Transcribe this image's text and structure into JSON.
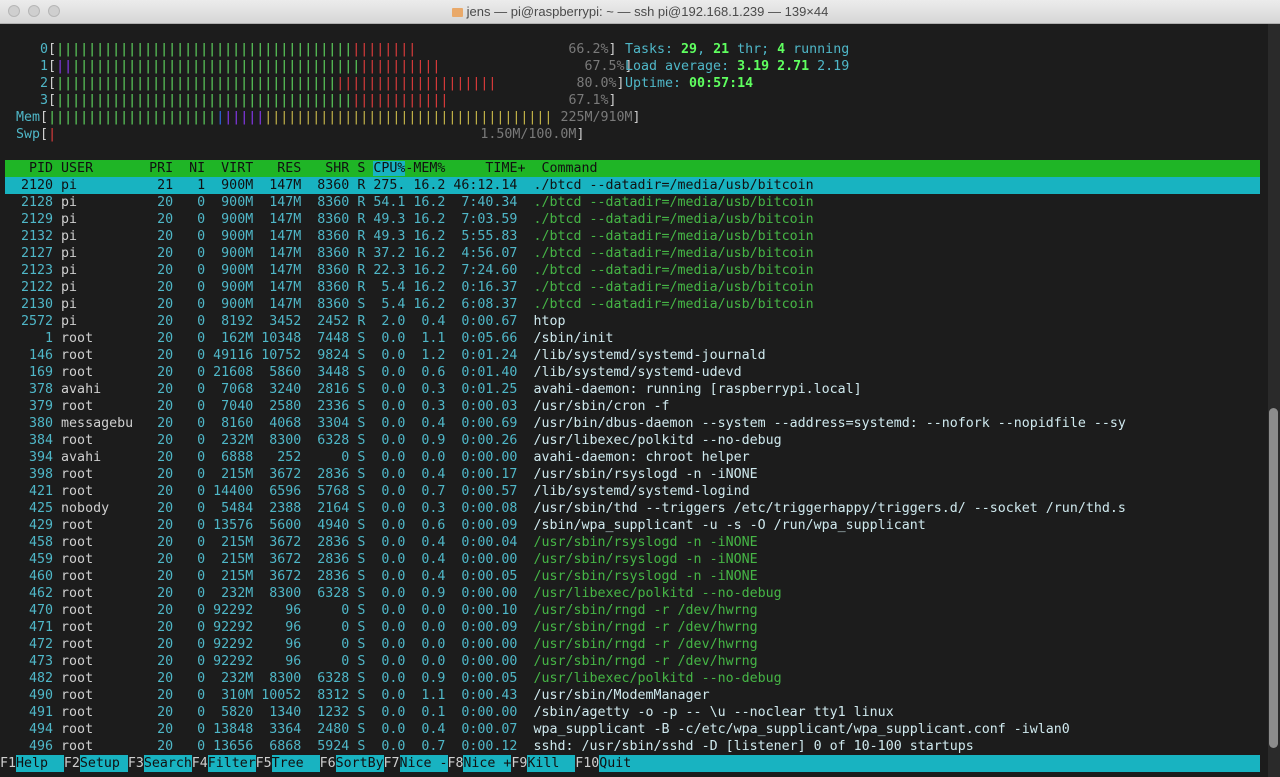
{
  "window": {
    "title": "jens — pi@raspberrypi: ~ — ssh pi@192.168.1.239 — 139×44"
  },
  "cpus": [
    {
      "id": "0",
      "percent": "66.2%"
    },
    {
      "id": "1",
      "percent": "67.5%"
    },
    {
      "id": "2",
      "percent": "80.0%"
    },
    {
      "id": "3",
      "percent": "67.1%"
    }
  ],
  "mem": {
    "label": "Mem",
    "value": "225M/910M"
  },
  "swp": {
    "label": "Swp",
    "value": "1.50M/100.0M"
  },
  "stats": {
    "tasks_label": "Tasks: ",
    "tasks": "29",
    "thr": "21",
    "thr_label": " thr; ",
    "running": "4",
    "running_label": " running",
    "load_label": "Load average: ",
    "load1": "3.19",
    "load5": "2.71",
    "load15": "2.19",
    "uptime_label": "Uptime: ",
    "uptime": "00:57:14"
  },
  "columns": {
    "pid": "PID",
    "user": "USER",
    "pri": "PRI",
    "ni": "NI",
    "virt": "VIRT",
    "res": "RES",
    "shr": "SHR",
    "s": "S",
    "cpu": "CPU%",
    "mem": "MEM%",
    "time": "TIME+",
    "command": "Command"
  },
  "processes": [
    {
      "pid": "2120",
      "user": "pi",
      "pri": "21",
      "ni": "1",
      "virt": "900M",
      "res": "147M",
      "shr": "8360",
      "s": "R",
      "cpu": "275.",
      "mem": "16.2",
      "time": "46:12.14",
      "command": "./btcd --datadir=/media/usb/bitcoin"
    },
    {
      "pid": "2128",
      "user": "pi",
      "pri": "20",
      "ni": "0",
      "virt": "900M",
      "res": "147M",
      "shr": "8360",
      "s": "R",
      "cpu": "54.1",
      "mem": "16.2",
      "time": "7:40.34",
      "command": "./btcd --datadir=/media/usb/bitcoin"
    },
    {
      "pid": "2129",
      "user": "pi",
      "pri": "20",
      "ni": "0",
      "virt": "900M",
      "res": "147M",
      "shr": "8360",
      "s": "R",
      "cpu": "49.3",
      "mem": "16.2",
      "time": "7:03.59",
      "command": "./btcd --datadir=/media/usb/bitcoin"
    },
    {
      "pid": "2132",
      "user": "pi",
      "pri": "20",
      "ni": "0",
      "virt": "900M",
      "res": "147M",
      "shr": "8360",
      "s": "R",
      "cpu": "49.3",
      "mem": "16.2",
      "time": "5:55.83",
      "command": "./btcd --datadir=/media/usb/bitcoin"
    },
    {
      "pid": "2127",
      "user": "pi",
      "pri": "20",
      "ni": "0",
      "virt": "900M",
      "res": "147M",
      "shr": "8360",
      "s": "R",
      "cpu": "37.2",
      "mem": "16.2",
      "time": "4:56.07",
      "command": "./btcd --datadir=/media/usb/bitcoin"
    },
    {
      "pid": "2123",
      "user": "pi",
      "pri": "20",
      "ni": "0",
      "virt": "900M",
      "res": "147M",
      "shr": "8360",
      "s": "R",
      "cpu": "22.3",
      "mem": "16.2",
      "time": "7:24.60",
      "command": "./btcd --datadir=/media/usb/bitcoin"
    },
    {
      "pid": "2122",
      "user": "pi",
      "pri": "20",
      "ni": "0",
      "virt": "900M",
      "res": "147M",
      "shr": "8360",
      "s": "R",
      "cpu": "5.4",
      "mem": "16.2",
      "time": "0:16.37",
      "command": "./btcd --datadir=/media/usb/bitcoin"
    },
    {
      "pid": "2130",
      "user": "pi",
      "pri": "20",
      "ni": "0",
      "virt": "900M",
      "res": "147M",
      "shr": "8360",
      "s": "S",
      "cpu": "5.4",
      "mem": "16.2",
      "time": "6:08.37",
      "command": "./btcd --datadir=/media/usb/bitcoin"
    },
    {
      "pid": "2572",
      "user": "pi",
      "pri": "20",
      "ni": "0",
      "virt": "8192",
      "res": "3452",
      "shr": "2452",
      "s": "R",
      "cpu": "2.0",
      "mem": "0.4",
      "time": "0:00.67",
      "command": "htop"
    },
    {
      "pid": "1",
      "user": "root",
      "pri": "20",
      "ni": "0",
      "virt": "162M",
      "res": "10348",
      "shr": "7448",
      "s": "S",
      "cpu": "0.0",
      "mem": "1.1",
      "time": "0:05.66",
      "command": "/sbin/init"
    },
    {
      "pid": "146",
      "user": "root",
      "pri": "20",
      "ni": "0",
      "virt": "49116",
      "res": "10752",
      "shr": "9824",
      "s": "S",
      "cpu": "0.0",
      "mem": "1.2",
      "time": "0:01.24",
      "command": "/lib/systemd/systemd-journald"
    },
    {
      "pid": "169",
      "user": "root",
      "pri": "20",
      "ni": "0",
      "virt": "21608",
      "res": "5860",
      "shr": "3448",
      "s": "S",
      "cpu": "0.0",
      "mem": "0.6",
      "time": "0:01.40",
      "command": "/lib/systemd/systemd-udevd"
    },
    {
      "pid": "378",
      "user": "avahi",
      "pri": "20",
      "ni": "0",
      "virt": "7068",
      "res": "3240",
      "shr": "2816",
      "s": "S",
      "cpu": "0.0",
      "mem": "0.3",
      "time": "0:01.25",
      "command": "avahi-daemon: running [raspberrypi.local]"
    },
    {
      "pid": "379",
      "user": "root",
      "pri": "20",
      "ni": "0",
      "virt": "7040",
      "res": "2580",
      "shr": "2336",
      "s": "S",
      "cpu": "0.0",
      "mem": "0.3",
      "time": "0:00.03",
      "command": "/usr/sbin/cron -f"
    },
    {
      "pid": "380",
      "user": "messagebu",
      "pri": "20",
      "ni": "0",
      "virt": "8160",
      "res": "4068",
      "shr": "3304",
      "s": "S",
      "cpu": "0.0",
      "mem": "0.4",
      "time": "0:00.69",
      "command": "/usr/bin/dbus-daemon --system --address=systemd: --nofork --nopidfile --sy"
    },
    {
      "pid": "384",
      "user": "root",
      "pri": "20",
      "ni": "0",
      "virt": "232M",
      "res": "8300",
      "shr": "6328",
      "s": "S",
      "cpu": "0.0",
      "mem": "0.9",
      "time": "0:00.26",
      "command": "/usr/libexec/polkitd --no-debug"
    },
    {
      "pid": "394",
      "user": "avahi",
      "pri": "20",
      "ni": "0",
      "virt": "6888",
      "res": "252",
      "shr": "0",
      "s": "S",
      "cpu": "0.0",
      "mem": "0.0",
      "time": "0:00.00",
      "command": "avahi-daemon: chroot helper"
    },
    {
      "pid": "398",
      "user": "root",
      "pri": "20",
      "ni": "0",
      "virt": "215M",
      "res": "3672",
      "shr": "2836",
      "s": "S",
      "cpu": "0.0",
      "mem": "0.4",
      "time": "0:00.17",
      "command": "/usr/sbin/rsyslogd -n -iNONE"
    },
    {
      "pid": "421",
      "user": "root",
      "pri": "20",
      "ni": "0",
      "virt": "14400",
      "res": "6596",
      "shr": "5768",
      "s": "S",
      "cpu": "0.0",
      "mem": "0.7",
      "time": "0:00.57",
      "command": "/lib/systemd/systemd-logind"
    },
    {
      "pid": "425",
      "user": "nobody",
      "pri": "20",
      "ni": "0",
      "virt": "5484",
      "res": "2388",
      "shr": "2164",
      "s": "S",
      "cpu": "0.0",
      "mem": "0.3",
      "time": "0:00.08",
      "command": "/usr/sbin/thd --triggers /etc/triggerhappy/triggers.d/ --socket /run/thd.s"
    },
    {
      "pid": "429",
      "user": "root",
      "pri": "20",
      "ni": "0",
      "virt": "13576",
      "res": "5600",
      "shr": "4940",
      "s": "S",
      "cpu": "0.0",
      "mem": "0.6",
      "time": "0:00.09",
      "command": "/sbin/wpa_supplicant -u -s -O /run/wpa_supplicant"
    },
    {
      "pid": "458",
      "user": "root",
      "pri": "20",
      "ni": "0",
      "virt": "215M",
      "res": "3672",
      "shr": "2836",
      "s": "S",
      "cpu": "0.0",
      "mem": "0.4",
      "time": "0:00.04",
      "command": "/usr/sbin/rsyslogd -n -iNONE"
    },
    {
      "pid": "459",
      "user": "root",
      "pri": "20",
      "ni": "0",
      "virt": "215M",
      "res": "3672",
      "shr": "2836",
      "s": "S",
      "cpu": "0.0",
      "mem": "0.4",
      "time": "0:00.00",
      "command": "/usr/sbin/rsyslogd -n -iNONE"
    },
    {
      "pid": "460",
      "user": "root",
      "pri": "20",
      "ni": "0",
      "virt": "215M",
      "res": "3672",
      "shr": "2836",
      "s": "S",
      "cpu": "0.0",
      "mem": "0.4",
      "time": "0:00.05",
      "command": "/usr/sbin/rsyslogd -n -iNONE"
    },
    {
      "pid": "462",
      "user": "root",
      "pri": "20",
      "ni": "0",
      "virt": "232M",
      "res": "8300",
      "shr": "6328",
      "s": "S",
      "cpu": "0.0",
      "mem": "0.9",
      "time": "0:00.00",
      "command": "/usr/libexec/polkitd --no-debug"
    },
    {
      "pid": "470",
      "user": "root",
      "pri": "20",
      "ni": "0",
      "virt": "92292",
      "res": "96",
      "shr": "0",
      "s": "S",
      "cpu": "0.0",
      "mem": "0.0",
      "time": "0:00.10",
      "command": "/usr/sbin/rngd -r /dev/hwrng"
    },
    {
      "pid": "471",
      "user": "root",
      "pri": "20",
      "ni": "0",
      "virt": "92292",
      "res": "96",
      "shr": "0",
      "s": "S",
      "cpu": "0.0",
      "mem": "0.0",
      "time": "0:00.09",
      "command": "/usr/sbin/rngd -r /dev/hwrng"
    },
    {
      "pid": "472",
      "user": "root",
      "pri": "20",
      "ni": "0",
      "virt": "92292",
      "res": "96",
      "shr": "0",
      "s": "S",
      "cpu": "0.0",
      "mem": "0.0",
      "time": "0:00.00",
      "command": "/usr/sbin/rngd -r /dev/hwrng"
    },
    {
      "pid": "473",
      "user": "root",
      "pri": "20",
      "ni": "0",
      "virt": "92292",
      "res": "96",
      "shr": "0",
      "s": "S",
      "cpu": "0.0",
      "mem": "0.0",
      "time": "0:00.00",
      "command": "/usr/sbin/rngd -r /dev/hwrng"
    },
    {
      "pid": "482",
      "user": "root",
      "pri": "20",
      "ni": "0",
      "virt": "232M",
      "res": "8300",
      "shr": "6328",
      "s": "S",
      "cpu": "0.0",
      "mem": "0.9",
      "time": "0:00.05",
      "command": "/usr/libexec/polkitd --no-debug"
    },
    {
      "pid": "490",
      "user": "root",
      "pri": "20",
      "ni": "0",
      "virt": "310M",
      "res": "10052",
      "shr": "8312",
      "s": "S",
      "cpu": "0.0",
      "mem": "1.1",
      "time": "0:00.43",
      "command": "/usr/sbin/ModemManager"
    },
    {
      "pid": "491",
      "user": "root",
      "pri": "20",
      "ni": "0",
      "virt": "5820",
      "res": "1340",
      "shr": "1232",
      "s": "S",
      "cpu": "0.0",
      "mem": "0.1",
      "time": "0:00.00",
      "command": "/sbin/agetty -o -p -- \\u --noclear tty1 linux"
    },
    {
      "pid": "494",
      "user": "root",
      "pri": "20",
      "ni": "0",
      "virt": "13848",
      "res": "3364",
      "shr": "2480",
      "s": "S",
      "cpu": "0.0",
      "mem": "0.4",
      "time": "0:00.07",
      "command": "wpa_supplicant -B -c/etc/wpa_supplicant/wpa_supplicant.conf -iwlan0"
    },
    {
      "pid": "496",
      "user": "root",
      "pri": "20",
      "ni": "0",
      "virt": "13656",
      "res": "6868",
      "shr": "5924",
      "s": "S",
      "cpu": "0.0",
      "mem": "0.7",
      "time": "0:00.12",
      "command": "sshd: /usr/sbin/sshd -D [listener] 0 of 10-100 startups"
    }
  ],
  "fkeys": [
    {
      "key": "F1",
      "label": "Help  "
    },
    {
      "key": "F2",
      "label": "Setup "
    },
    {
      "key": "F3",
      "label": "Search"
    },
    {
      "key": "F4",
      "label": "Filter"
    },
    {
      "key": "F5",
      "label": "Tree  "
    },
    {
      "key": "F6",
      "label": "SortBy"
    },
    {
      "key": "F7",
      "label": "Nice -"
    },
    {
      "key": "F8",
      "label": "Nice +"
    },
    {
      "key": "F9",
      "label": "Kill  "
    },
    {
      "key": "F10",
      "label": "Quit"
    }
  ],
  "colors": {
    "header_bg": "#1fb526",
    "selection_bg": "#18b3c1",
    "text_green": "#5fd75f",
    "text_cyan": "#4fb7c8"
  }
}
